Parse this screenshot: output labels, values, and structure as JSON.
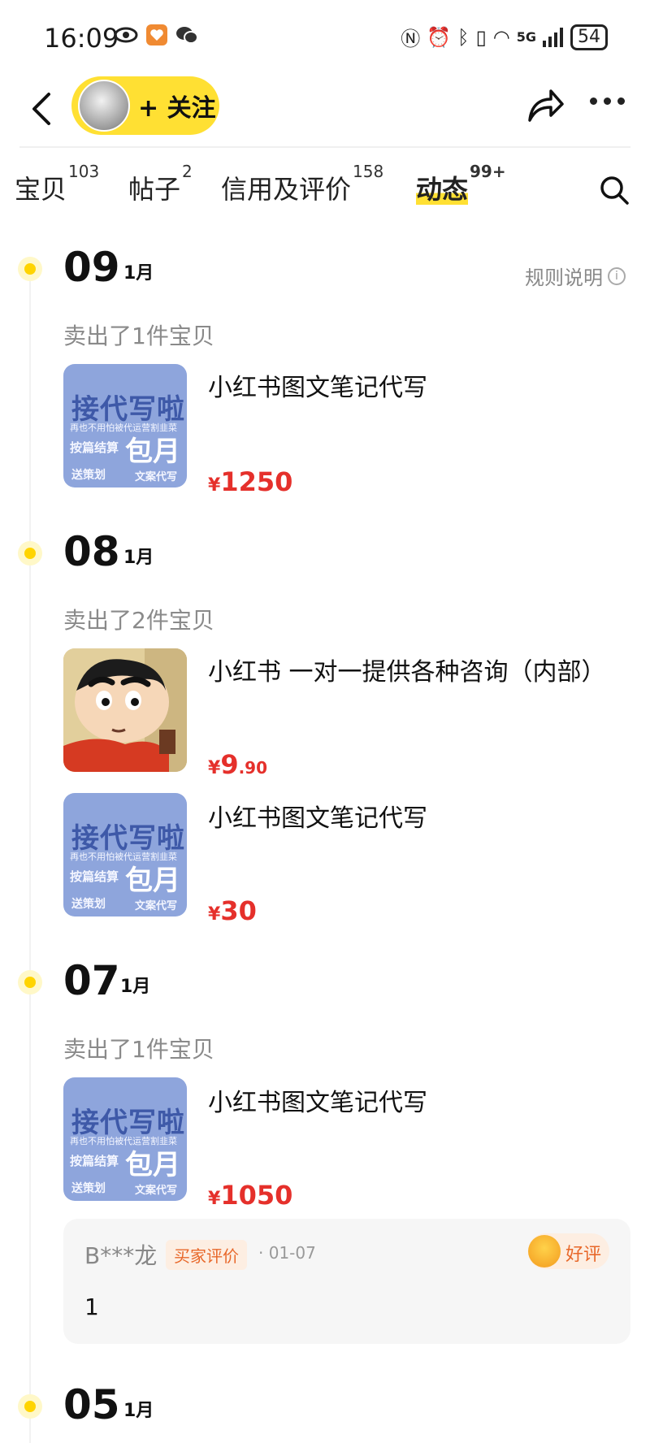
{
  "status_bar": {
    "time": "16:09",
    "network": "5G",
    "battery": "54"
  },
  "header": {
    "follow_label": "+ 关注"
  },
  "tabs": [
    {
      "label": "宝贝",
      "count": "103"
    },
    {
      "label": "帖子",
      "count": "2"
    },
    {
      "label": "信用及评价",
      "count": "158"
    },
    {
      "label": "动态",
      "count": "99+"
    }
  ],
  "rules_label": "规则说明",
  "timeline": [
    {
      "day": "09",
      "month": "1月",
      "summary": "卖出了1件宝贝",
      "items": [
        {
          "title": "小红书图文笔记代写",
          "currency": "¥",
          "price": "1250",
          "decimal": ""
        }
      ]
    },
    {
      "day": "08",
      "month": "1月",
      "summary": "卖出了2件宝贝",
      "items": [
        {
          "title": "小红书 一对一提供各种咨询（内部）",
          "currency": "¥",
          "price": "9",
          "decimal": ".90"
        },
        {
          "title": "小红书图文笔记代写",
          "currency": "¥",
          "price": "30",
          "decimal": ""
        }
      ]
    },
    {
      "day": "07",
      "month": "1月",
      "summary": "卖出了1件宝贝",
      "items": [
        {
          "title": "小红书图文笔记代写",
          "currency": "¥",
          "price": "1050",
          "decimal": ""
        }
      ],
      "review": {
        "user": "B***龙",
        "badge": "买家评价",
        "date": "· 01-07",
        "rating": "好评",
        "content": "1"
      }
    },
    {
      "day": "05",
      "month": "1月"
    }
  ],
  "thumb_text": {
    "line1": "接代写啦",
    "line2": "再也不用怕被代运营割韭菜",
    "line3": "按篇结算",
    "line4": "包月",
    "line5": "送策划",
    "line6": "文案代写"
  }
}
